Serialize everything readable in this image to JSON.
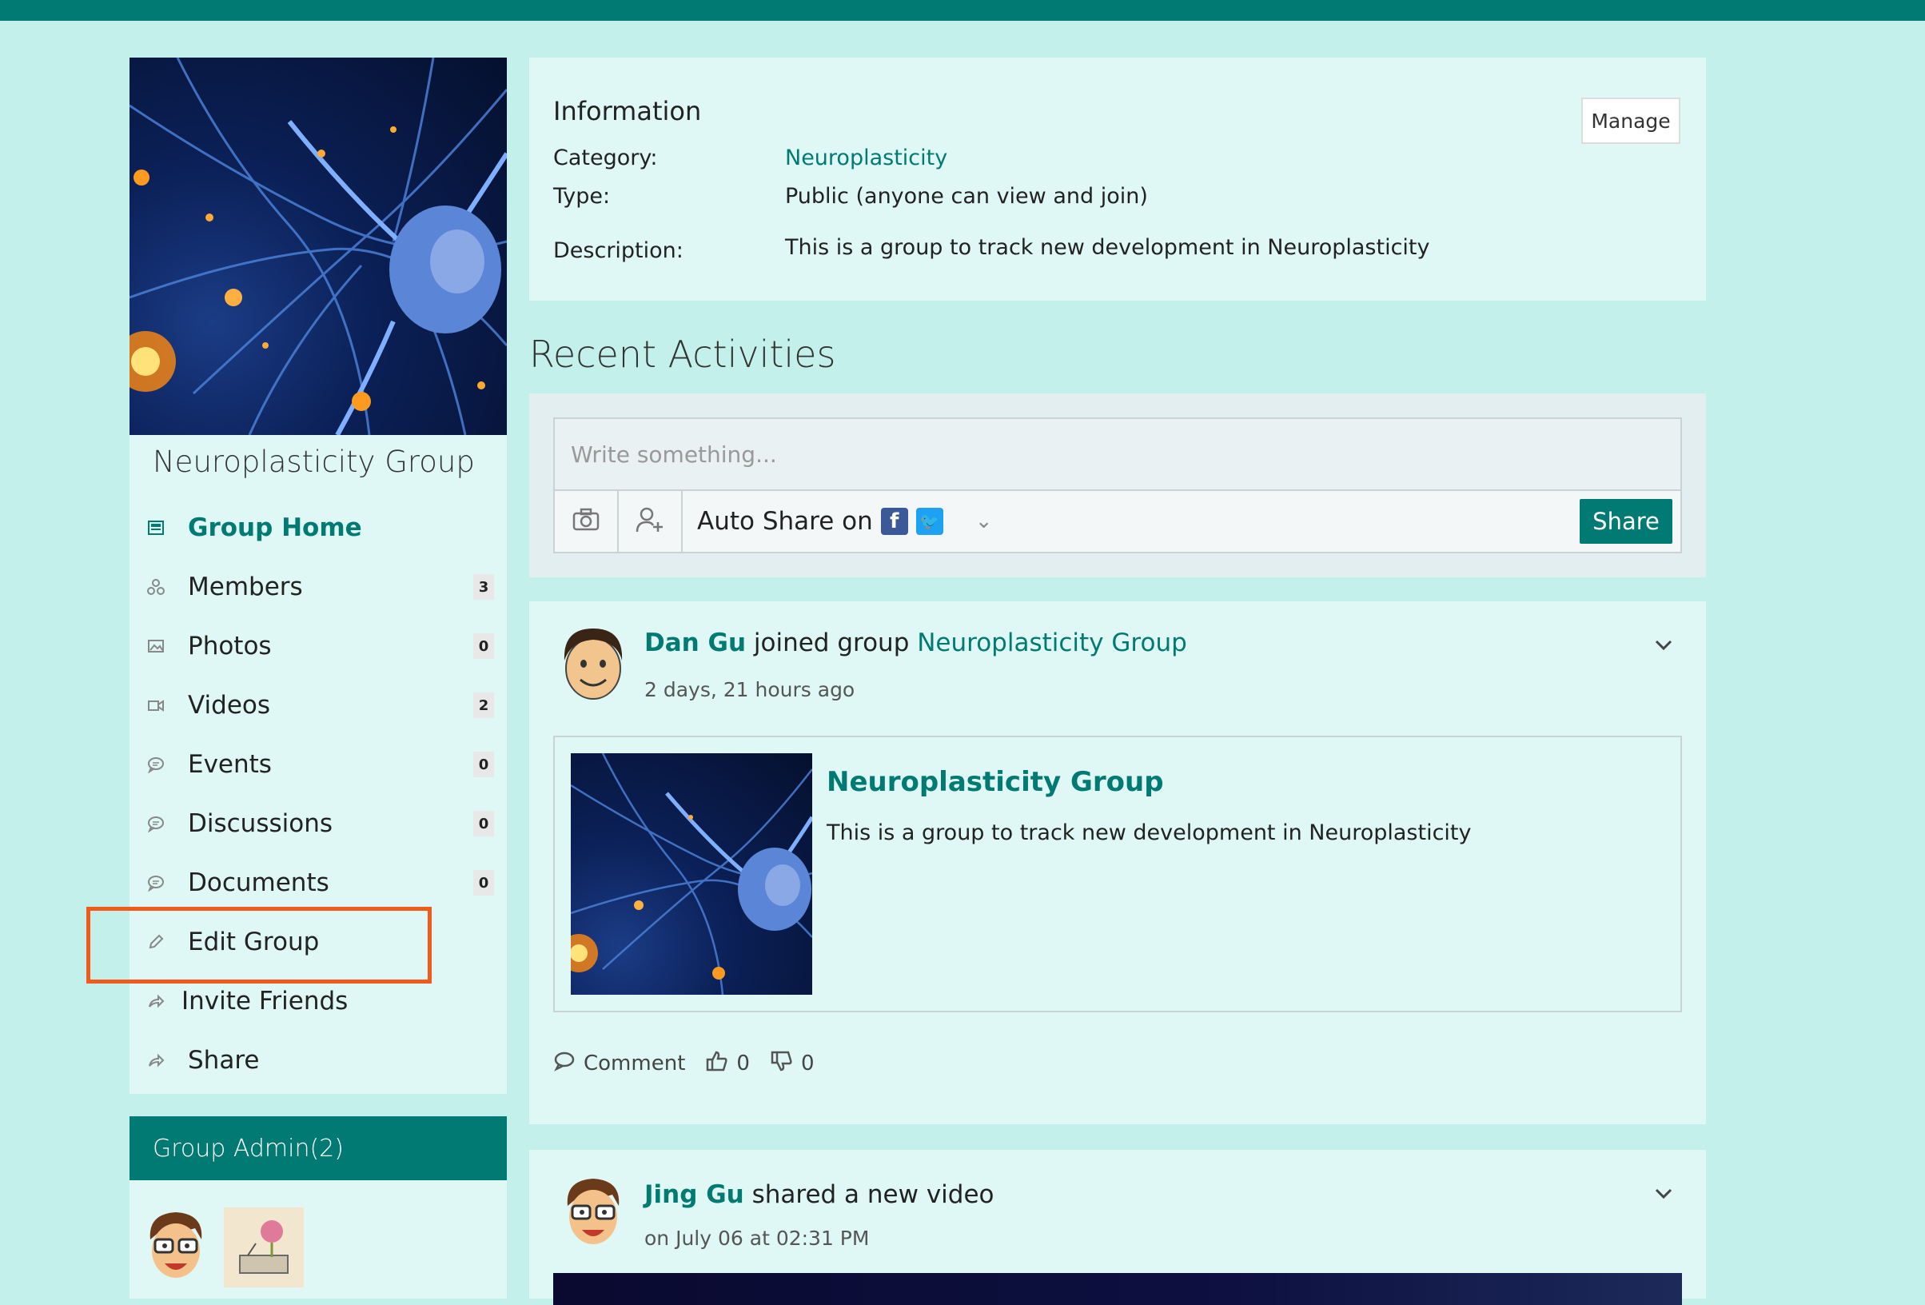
{
  "sidebar": {
    "group_name": "Neuroplasticity Group",
    "items": [
      {
        "label": "Group Home",
        "icon": "home-icon",
        "count": null
      },
      {
        "label": "Members",
        "icon": "members-icon",
        "count": "3"
      },
      {
        "label": "Photos",
        "icon": "photo-icon",
        "count": "0"
      },
      {
        "label": "Videos",
        "icon": "video-icon",
        "count": "2"
      },
      {
        "label": "Events",
        "icon": "chat-icon",
        "count": "0"
      },
      {
        "label": "Discussions",
        "icon": "chat-icon",
        "count": "0"
      },
      {
        "label": "Documents",
        "icon": "chat-icon",
        "count": "0"
      },
      {
        "label": "Edit Group",
        "icon": "pencil-icon",
        "count": null
      },
      {
        "label": "Invite Friends",
        "icon": "share-arrow-icon",
        "count": null
      },
      {
        "label": "Share",
        "icon": "share-arrow-icon",
        "count": null
      }
    ],
    "admin_title": "Group Admin(2)"
  },
  "info": {
    "title": "Information",
    "manage_label": "Manage",
    "category_label": "Category:",
    "category_value": "Neuroplasticity",
    "type_label": "Type:",
    "type_value": "Public (anyone can view and join)",
    "description_label": "Description:",
    "description_value": "This is a group to track new development in Neuroplasticity"
  },
  "activities": {
    "title": "Recent Activities",
    "composer": {
      "placeholder": "Write something...",
      "auto_share_label": "Auto Share on",
      "share_label": "Share"
    },
    "posts": [
      {
        "actor": "Dan Gu",
        "action": "joined group",
        "target": "Neuroplasticity Group",
        "time": "2 days, 21 hours ago",
        "embed_title": "Neuroplasticity Group",
        "embed_desc": "This is a group to track new development in Neuroplasticity",
        "comment_label": "Comment",
        "likes": "0",
        "dislikes": "0"
      },
      {
        "actor": "Jing Gu",
        "action": "shared a new video",
        "time": "on July 06 at 02:31 PM"
      }
    ]
  },
  "colors": {
    "brand": "#007a72",
    "page_bg": "#c4f0ec",
    "card_bg": "#dff8f5",
    "highlight": "#f05a1a"
  }
}
